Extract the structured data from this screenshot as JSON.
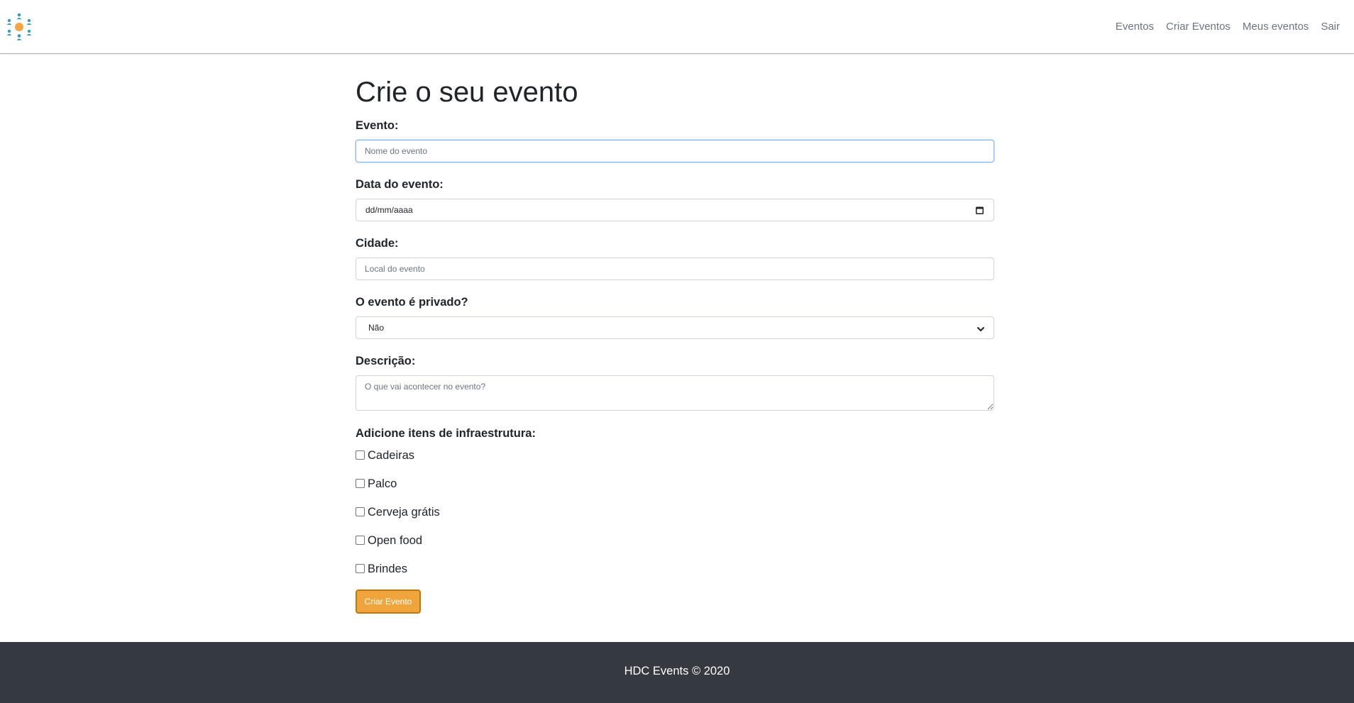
{
  "header": {
    "logo_icon": "event-people-logo-icon",
    "nav": [
      {
        "label": "Eventos"
      },
      {
        "label": "Criar Eventos"
      },
      {
        "label": "Meus eventos"
      },
      {
        "label": "Sair"
      }
    ]
  },
  "form": {
    "title": "Crie o seu evento",
    "event": {
      "label": "Evento:",
      "placeholder": "Nome do evento",
      "value": ""
    },
    "date": {
      "label": "Data do evento:",
      "value": "dd/mm/aaaa",
      "icon": "calendar-icon"
    },
    "city": {
      "label": "Cidade:",
      "placeholder": "Local do evento",
      "value": ""
    },
    "private": {
      "label": "O evento é privado?",
      "selected": "Não",
      "icon": "chevron-down-icon"
    },
    "description": {
      "label": "Descrição:",
      "placeholder": "O que vai acontecer no evento?"
    },
    "infra": {
      "label": "Adicione itens de infraestrutura:",
      "items": [
        {
          "label": "Cadeiras",
          "checked": false
        },
        {
          "label": "Palco",
          "checked": false
        },
        {
          "label": "Cerveja grátis",
          "checked": false
        },
        {
          "label": "Open food",
          "checked": false
        },
        {
          "label": "Brindes",
          "checked": false
        }
      ]
    },
    "submit_label": "Criar Evento"
  },
  "footer": {
    "text": "HDC Events © 2020"
  },
  "colors": {
    "accent": "#f0a53c",
    "accent_border": "#c0770e",
    "footer_bg": "#343a40",
    "focus_border": "#86b7fe"
  }
}
